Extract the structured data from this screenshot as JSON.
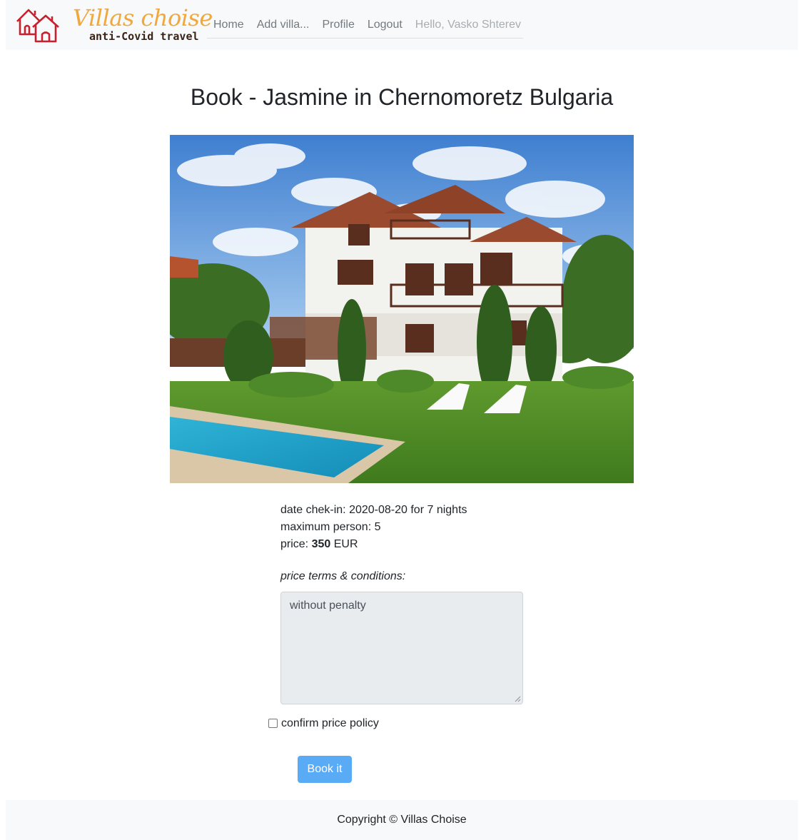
{
  "brand": {
    "name": "Villas choise",
    "tagline": "anti-Covid travel",
    "colors": {
      "name": "#f0a83c",
      "houses": "#c8202c",
      "tagline": "#3a2418"
    }
  },
  "nav": {
    "items": [
      "Home",
      "Add villa...",
      "Profile",
      "Logout"
    ],
    "greeting": "Hello, Vasko Shterev"
  },
  "page": {
    "title": "Book - Jasmine in Chernomoretz Bulgaria"
  },
  "details": {
    "checkin_prefix": "date chek-in: ",
    "checkin_date": "2020-08-20",
    "checkin_suffix": " for 7 nights",
    "max_person_label": "maximum person: ",
    "max_person": "5",
    "price_label": "price: ",
    "price": "350",
    "currency": " EUR"
  },
  "terms": {
    "label": "price terms & conditions:",
    "text": "without penalty"
  },
  "confirm": {
    "label": "confirm price policy",
    "checked": false
  },
  "actions": {
    "book_label": "Book it",
    "button_color": "#5aabf5"
  },
  "footer": {
    "copyright": "Copyright © Villas Choise"
  }
}
